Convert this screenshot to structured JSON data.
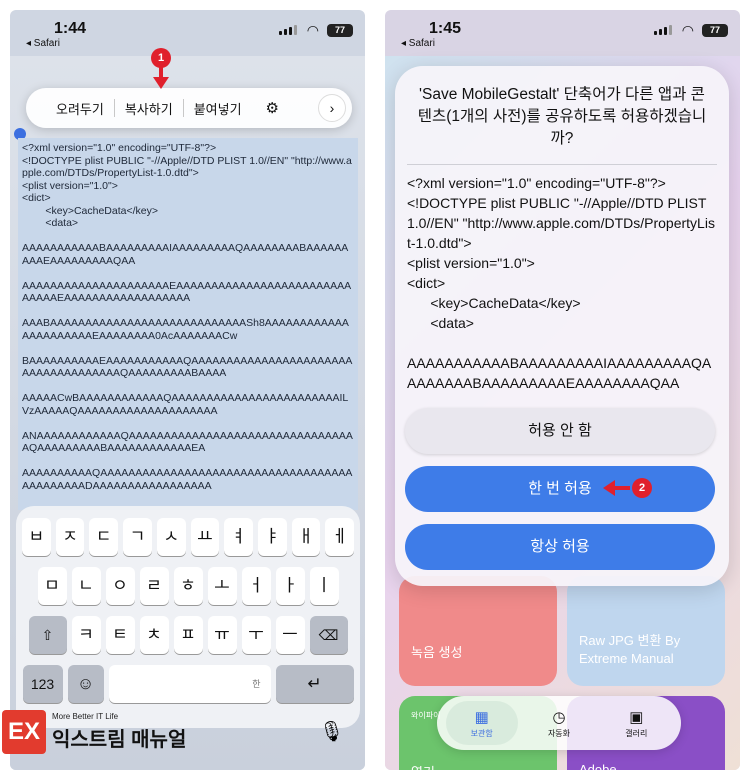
{
  "left_phone": {
    "status": {
      "time": "1:44",
      "back_label": "◂ Safari",
      "battery": "77",
      "wifi": "wifi-icon",
      "signal": "signal-icon"
    },
    "edit_menu": {
      "cut": "오려두기",
      "copy": "복사하기",
      "paste": "붙여넣기",
      "gear_icon": "gear-icon",
      "more_icon": "chevron-right-icon"
    },
    "step_badge": "1",
    "selected_text": "<?xml version=\"1.0\" encoding=\"UTF-8\"?>\n<!DOCTYPE plist PUBLIC \"-//Apple//DTD PLIST 1.0//EN\" \"http://www.apple.com/DTDs/PropertyList-1.0.dtd\">\n<plist version=\"1.0\">\n<dict>\n        <key>CacheData</key>\n        <data>\n\nAAAAAAAAAAABAAAAAAAAAIAAAAAAAAAQAAAAAAAABAAAAAAAAAEAAAAAAAAAQAA\n\nAAAAAAAAAAAAAAAAAAAAAEAAAAAAAAAAAAAAAAAAAAAAAAAAAAAAEAAAAAAAAAAAAAAAAAA\n\nAAABAAAAAAAAAAAAAAAAAAAAAAAAAAAASh8AAAAAAAAAAAAAAAAAAAAAAEAAAAAAAA0AcAAAAAAACw\n\nBAAAAAAAAAAEAAAAAAAAAAAQAAAAAAAAAAAAAAAAAAAAAAAAAAAAAAAAAAAAAQAAAAAAAAABAAAA\n\nAAAAACwBAAAAAAAAAAAAQAAAAAAAAAAAAAAAAAAAAAAAAILVzAAAAAQAAAAAAAAAAAAAAAAAAAA\n\nANAAAAAAAAAAAAQAAAAAAAAAAAAAAAAAAAAAAAAAAAAAAAAAQAAAAAAAAABAAAAAAAAAAAAEA\n\nAAAAAAAAAAQAAAAAAAAAAAAAAAAAAAAAAAAAAAAAAAAAAAAAAAAAAAAADAAAAAAAAAAAAAAAAA",
    "keyboard": {
      "row1": [
        "ㅂ",
        "ㅈ",
        "ㄷ",
        "ㄱ",
        "ㅅ",
        "ㅛ",
        "ㅕ",
        "ㅑ",
        "ㅐ",
        "ㅔ"
      ],
      "row2": [
        "ㅁ",
        "ㄴ",
        "ㅇ",
        "ㄹ",
        "ㅎ",
        "ㅗ",
        "ㅓ",
        "ㅏ",
        "ㅣ"
      ],
      "row3": [
        "ㅋ",
        "ㅌ",
        "ㅊ",
        "ㅍ",
        "ㅠ",
        "ㅜ",
        "ㅡ"
      ],
      "shift_icon": "shift-icon",
      "delete_icon": "delete-icon",
      "num_label": "123",
      "emoji_icon": "emoji-icon",
      "space_hint": "한",
      "return_icon": "return-icon",
      "mic_icon": "mic-icon",
      "globe_icon": "globe-icon"
    },
    "logo": {
      "mark": "EX",
      "tagline": "More Better IT Life",
      "name": "익스트림 매뉴얼"
    }
  },
  "right_phone": {
    "status": {
      "time": "1:45",
      "back_label": "◂ Safari",
      "battery": "77",
      "wifi": "wifi-icon",
      "signal": "signal-icon"
    },
    "dialog": {
      "title": "'Save MobileGestalt' 단축어가 다른 앱과 콘텐츠(1개의 사전)를 공유하도록 허용하겠습니까?",
      "body": "<?xml version=\"1.0\" encoding=\"UTF-8\"?>\n<!DOCTYPE plist PUBLIC \"-//Apple//DTD PLIST 1.0//EN\" \"http://www.apple.com/DTDs/PropertyList-1.0.dtd\">\n<plist version=\"1.0\">\n<dict>\n      <key>CacheData</key>\n      <data>\n\nAAAAAAAAAAABAAAAAAAAAIAAAAAAAAAQAAAAAAAABAAAAAAAAAEAAAAAAAAQAA",
      "deny": "허용 안 함",
      "once": "한 번 허용",
      "always": "항상 허용"
    },
    "step_badge": "2",
    "background_tiles": {
      "record": "녹음 생성",
      "raw": "Raw JPG 변환 By Extreme Manual",
      "wifi_tile": "와이파이",
      "open_tile": "열기",
      "adobe_tile": "Adobe"
    },
    "tabbar": {
      "library": "보관함",
      "automation": "자동화",
      "gallery": "갤러리"
    }
  }
}
